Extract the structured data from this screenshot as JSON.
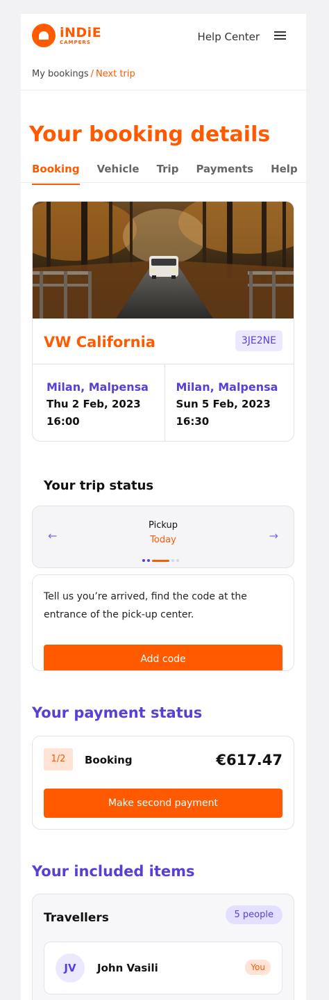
{
  "header": {
    "brand_word": "iNDiE",
    "brand_sub": "CAMPERS",
    "help_center": "Help Center",
    "menu_icon": "hamburger-menu-icon"
  },
  "breadcrumb": {
    "parent": "My bookings",
    "separator": "/",
    "current": "Next trip"
  },
  "page": {
    "title": "Your booking details",
    "tabs": [
      {
        "label": "Booking",
        "active": true
      },
      {
        "label": "Vehicle",
        "active": false
      },
      {
        "label": "Trip",
        "active": false
      },
      {
        "label": "Payments",
        "active": false
      },
      {
        "label": "Help",
        "active": false
      }
    ]
  },
  "booking": {
    "vehicle_name": "VW California",
    "booking_code": "3JE2NE",
    "pickup": {
      "location": "Milan, Malpensa",
      "date": "Thu 2 Feb, 2023",
      "time": "16:00"
    },
    "dropoff": {
      "location": "Milan, Malpensa",
      "date": "Sun 5 Feb, 2023",
      "time": "16:30"
    }
  },
  "trip_status": {
    "heading": "Your trip status",
    "step_label": "Pickup",
    "step_value": "Today",
    "prev_icon": "arrow-left-icon",
    "next_icon": "arrow-right-icon",
    "instruction": "Tell us you’re arrived, find the code at the entrance of the pick-up center.",
    "button": "Add code"
  },
  "payment": {
    "heading": "Your payment status",
    "step": "1/2",
    "label": "Booking",
    "amount": "€617.47",
    "button": "Make second payment"
  },
  "included": {
    "heading": "Your included items",
    "travellers_label": "Travellers",
    "travellers_count": "5 people",
    "first_traveller": {
      "initials": "JV",
      "name": "John Vasili",
      "badge": "You"
    }
  },
  "colors": {
    "brand_orange": "#ff5a00",
    "accent_purple": "#5a3fd6"
  }
}
